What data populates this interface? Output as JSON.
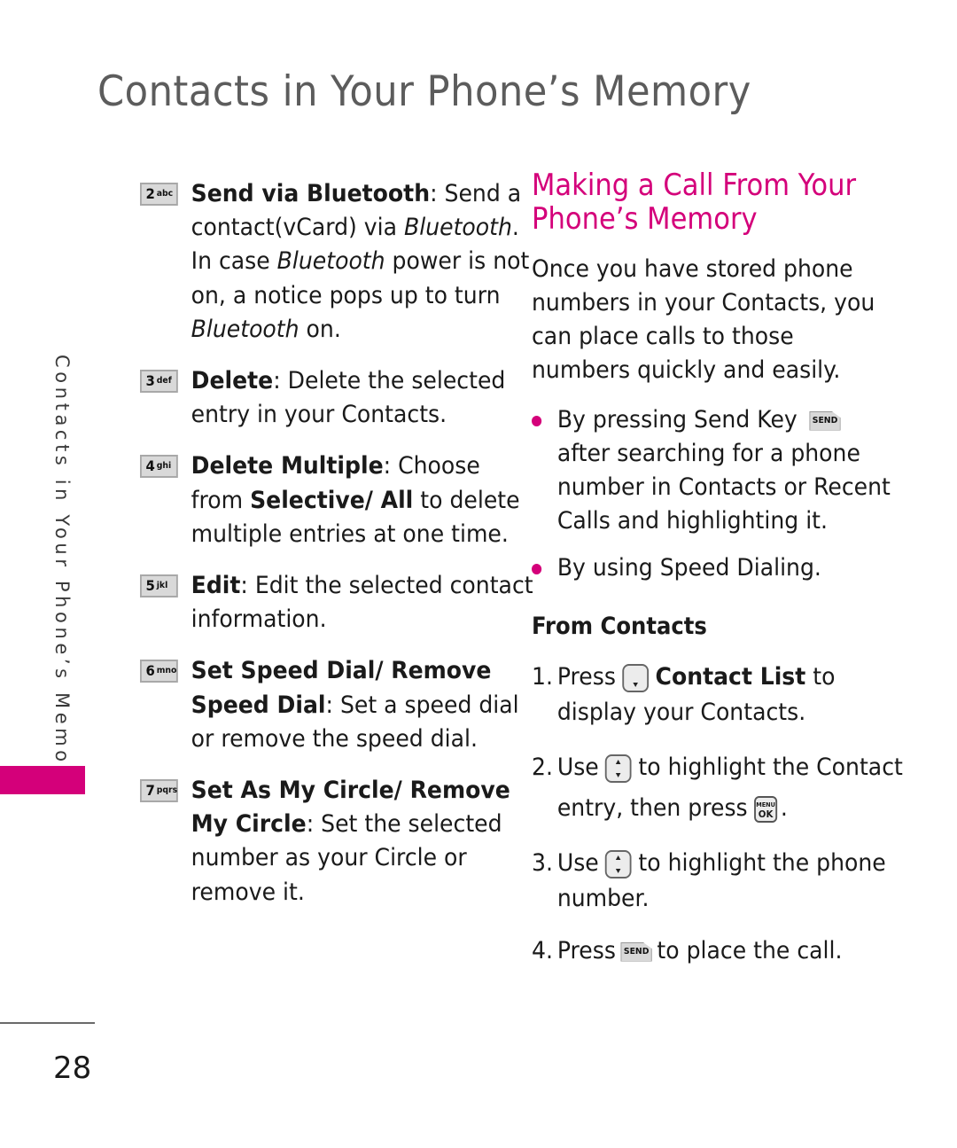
{
  "header": {
    "title": "Contacts in Your Phone’s Memory"
  },
  "side_tab": {
    "label": "Contacts in Your Phone’s Memory",
    "accent_color": "#d4007a"
  },
  "footer": {
    "page_number": "28"
  },
  "options": [
    {
      "key_number": "2",
      "key_letters": "abc",
      "term": "Send via Bluetooth",
      "sep": ": ",
      "text_1": "Send a contact(vCard) via ",
      "italic_1": "Bluetooth",
      "text_2": ". In case ",
      "italic_2": "Bluetooth",
      "text_3": " power is not on, a notice pops up to turn ",
      "italic_3": "Bluetooth",
      "text_4": " on."
    },
    {
      "key_number": "3",
      "key_letters": "def",
      "term": "Delete",
      "sep": ": ",
      "text": "Delete the selected entry in your Contacts."
    },
    {
      "key_number": "4",
      "key_letters": "ghi",
      "term": "Delete Multiple",
      "sep": ": ",
      "text_1": "Choose from ",
      "bold_1": "Selective/ All",
      "text_2": " to delete multiple entries at one time."
    },
    {
      "key_number": "5",
      "key_letters": "jkl",
      "term": "Edit",
      "sep": ": ",
      "text": "Edit the selected contact information."
    },
    {
      "key_number": "6",
      "key_letters": "mno",
      "term": "Set Speed Dial/ Remove Speed Dial",
      "sep": ": ",
      "text": "Set a speed dial or remove the speed dial."
    },
    {
      "key_number": "7",
      "key_letters": "pqrs",
      "term": "Set As My Circle/ Remove My Circle",
      "sep": ": ",
      "text": "Set the selected number as your Circle or remove it."
    }
  ],
  "section": {
    "title": "Making a Call From Your Phone’s Memory",
    "intro": "Once you have stored phone numbers in your Contacts, you can place calls to those numbers quickly and easily.",
    "bullets": [
      {
        "text_1": "By pressing Send Key",
        "icon": "send-key-icon",
        "icon_label": "SEND",
        "text_2": "after searching for a phone number in Contacts or Recent Calls and highlighting it."
      },
      {
        "text_1": "By using Speed Dialing."
      }
    ],
    "subheading": "From Contacts",
    "steps": [
      {
        "num": "1.",
        "text_1": "Press",
        "icon": "nav-down-key-icon",
        "bold": "Contact List",
        "text_2": " to display your Contacts."
      },
      {
        "num": "2.",
        "text_1": "Use",
        "icon": "nav-up-down-key-icon",
        "text_2": "to highlight the Contact entry, then press",
        "icon_2": "menu-ok-key-icon",
        "icon_2_top": "MENU",
        "icon_2_bottom": "OK",
        "text_3": "."
      },
      {
        "num": "3.",
        "text_1": "Use",
        "icon": "nav-up-down-key-icon",
        "text_2": "to highlight the phone number."
      },
      {
        "num": "4.",
        "text_1": "Press",
        "icon": "send-key-icon",
        "icon_label": "SEND",
        "text_2": "to place the call."
      }
    ]
  }
}
